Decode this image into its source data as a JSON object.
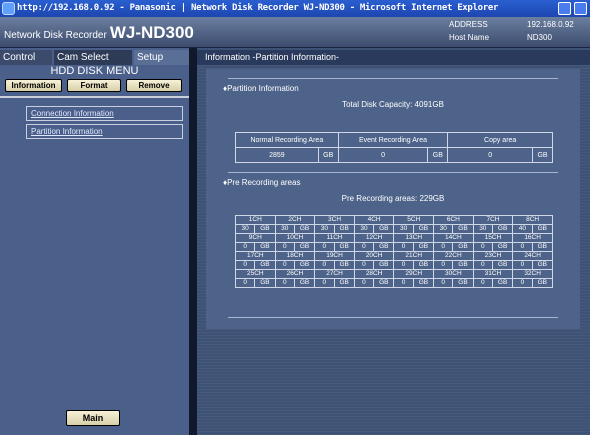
{
  "window": {
    "title": "http://192.168.0.92 - Panasonic | Network Disk Recorder WJ-ND300 - Microsoft Internet Explorer"
  },
  "header": {
    "product_small": "Network Disk Recorder",
    "product_big": "WJ-ND300",
    "address_label": "ADDRESS",
    "address_value": "192.168.0.92",
    "host_label": "Host Name",
    "host_value": "ND300"
  },
  "tabs": {
    "control": "Control",
    "cam_select": "Cam Select",
    "setup": "Setup"
  },
  "menu": {
    "title": "HDD DISK MENU",
    "buttons": {
      "information": "Information",
      "format": "Format",
      "remove": "Remove"
    },
    "links": {
      "connection": "Connection Information",
      "partition": "Partition Information"
    },
    "main_button": "Main"
  },
  "content": {
    "title": "Information -Partition Information-",
    "partition_section": "♦Partition Information",
    "total_capacity": "Total Disk Capacity: 4091GB",
    "partition_table": {
      "headers": [
        "Normal Recording Area",
        "Event Recording Area",
        "Copy area"
      ],
      "values": [
        "2859",
        "0",
        "0"
      ],
      "unit": "GB"
    },
    "prerec_section": "♦Pre Recording areas",
    "prerec_total": "Pre Recording areas: 229GB",
    "channels": {
      "unit": "GB",
      "rows": [
        {
          "names": [
            "1CH",
            "2CH",
            "3CH",
            "4CH",
            "5CH",
            "6CH",
            "7CH",
            "8CH"
          ],
          "values": [
            "30",
            "30",
            "30",
            "30",
            "30",
            "30",
            "30",
            "40"
          ]
        },
        {
          "names": [
            "9CH",
            "10CH",
            "11CH",
            "12CH",
            "13CH",
            "14CH",
            "15CH",
            "16CH"
          ],
          "values": [
            "0",
            "0",
            "0",
            "0",
            "0",
            "0",
            "0",
            "0"
          ]
        },
        {
          "names": [
            "17CH",
            "18CH",
            "19CH",
            "20CH",
            "21CH",
            "22CH",
            "23CH",
            "24CH"
          ],
          "values": [
            "0",
            "0",
            "0",
            "0",
            "0",
            "0",
            "0",
            "0"
          ]
        },
        {
          "names": [
            "25CH",
            "26CH",
            "27CH",
            "28CH",
            "29CH",
            "30CH",
            "31CH",
            "32CH"
          ],
          "values": [
            "0",
            "0",
            "0",
            "0",
            "0",
            "0",
            "0",
            "0"
          ]
        }
      ]
    }
  }
}
